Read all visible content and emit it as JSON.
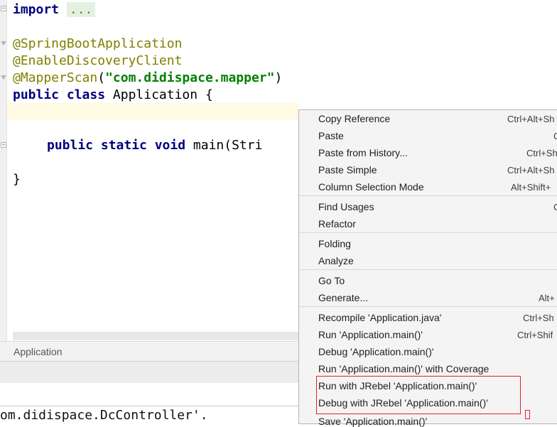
{
  "editor": {
    "line_import_kw": "import",
    "line_import_folded": "...",
    "ann_springboot": "@SpringBootApplication",
    "ann_discovery": "@EnableDiscoveryClient",
    "ann_mapperscan": "@MapperScan",
    "mapperscan_open": "(",
    "mapperscan_arg": "\"com.didispace.mapper\"",
    "mapperscan_close": ")",
    "class_public": "public",
    "class_kw": "class",
    "class_name": " Application {",
    "main_kw": "public static void",
    "main_rest": " main(Stri",
    "close_brace": "}"
  },
  "breadcrumb": {
    "label": "Application"
  },
  "console": {
    "text": "om.didispace.DcController'."
  },
  "context_menu": {
    "items": [
      {
        "label": "Copy Reference",
        "shortcut": "Ctrl+Alt+Sh"
      },
      {
        "label": "Paste",
        "shortcut": "C"
      },
      {
        "label": "Paste from History...",
        "shortcut": "Ctrl+Sh"
      },
      {
        "label": "Paste Simple",
        "shortcut": "Ctrl+Alt+Sh"
      },
      {
        "label": "Column Selection Mode",
        "shortcut": "Alt+Shift+"
      },
      {
        "label": "Find Usages",
        "shortcut": "C"
      },
      {
        "label": "Refactor",
        "shortcut": ""
      },
      {
        "label": "Folding",
        "shortcut": ""
      },
      {
        "label": "Analyze",
        "shortcut": ""
      },
      {
        "label": "Go To",
        "shortcut": ""
      },
      {
        "label": "Generate...",
        "shortcut": "Alt+"
      },
      {
        "label": "Recompile 'Application.java'",
        "shortcut": "Ctrl+Sh"
      },
      {
        "label": "Run 'Application.main()'",
        "shortcut": "Ctrl+Shif"
      },
      {
        "label": "Debug 'Application.main()'",
        "shortcut": ""
      },
      {
        "label": "Run 'Application.main()' with Coverage",
        "shortcut": ""
      },
      {
        "label": "Run with JRebel 'Application.main()'",
        "shortcut": ""
      },
      {
        "label": "Debug with JRebel 'Application.main()'",
        "shortcut": ""
      },
      {
        "label": "Save 'Application.main()'",
        "shortcut": ""
      }
    ]
  },
  "colors": {
    "highlight_box": "#e8202a",
    "keyword": "#000080",
    "annotation": "#808000",
    "string": "#008000"
  }
}
